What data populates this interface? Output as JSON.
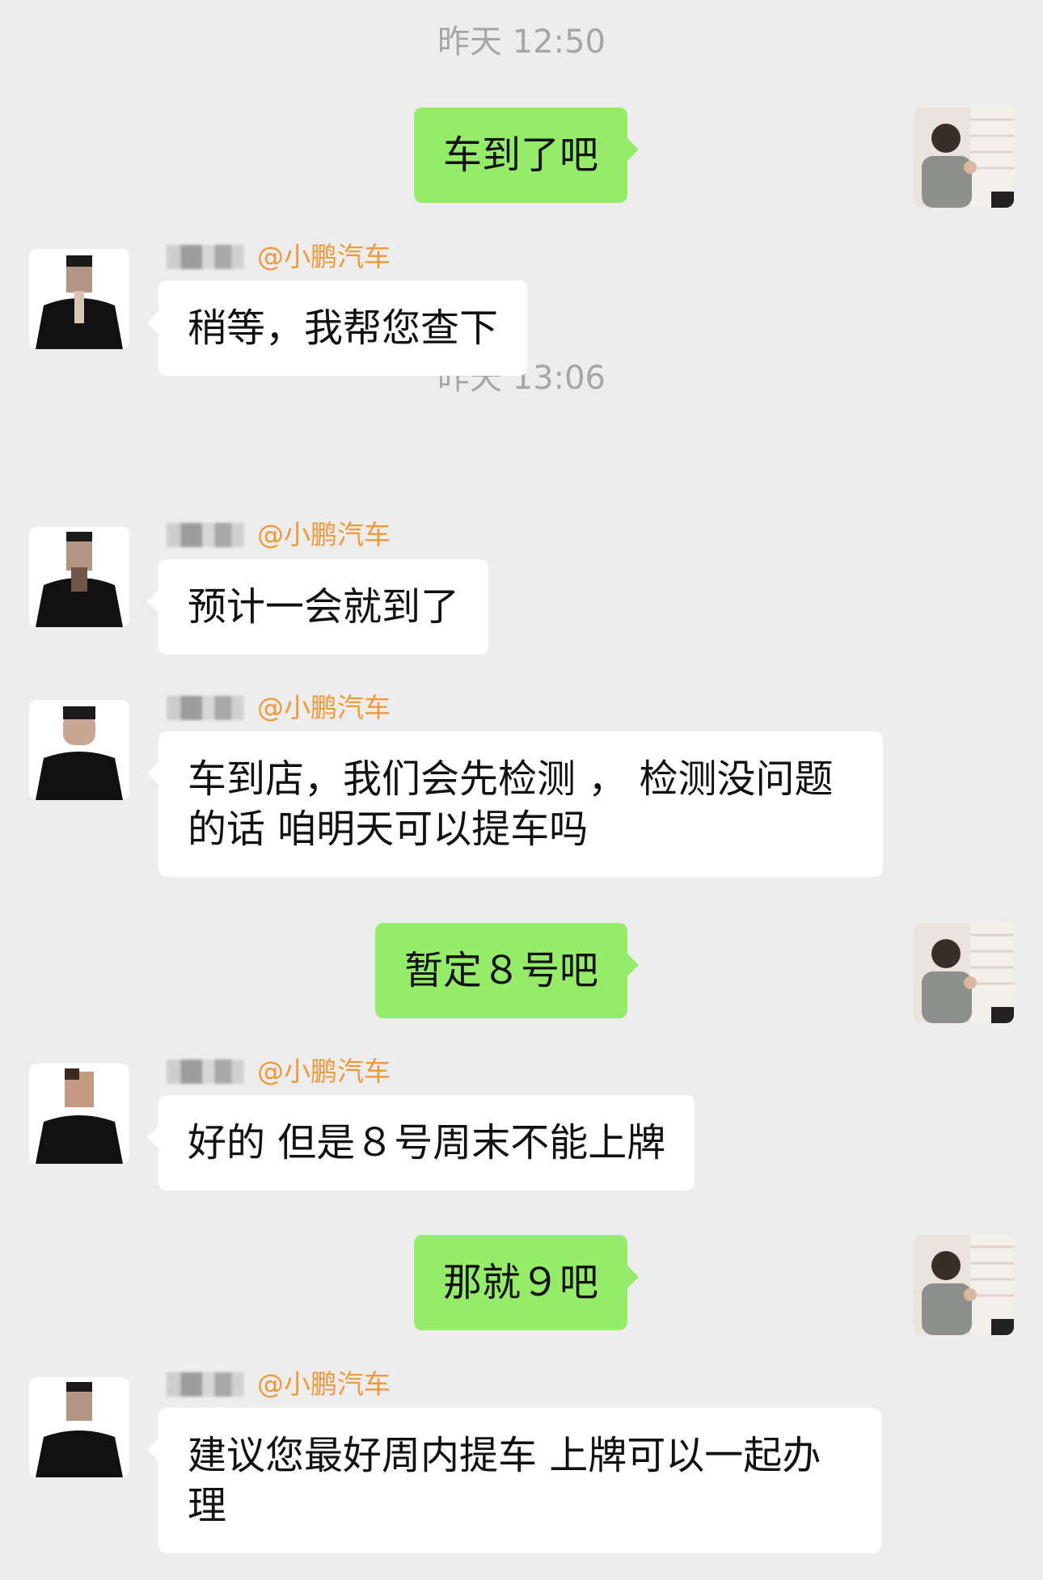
{
  "timestamps": [
    "昨天 12:50",
    "昨天 13:06"
  ],
  "messages": [
    {
      "side": "out",
      "text": "车到了吧"
    },
    {
      "side": "in",
      "company": "@小鹏汽车",
      "text": "稍等，我帮您查下"
    },
    {
      "side": "in",
      "company": "@小鹏汽车",
      "text": "预计一会就到了"
    },
    {
      "side": "in",
      "company": "@小鹏汽车",
      "text": "车到店，我们会先检测 ， 检测没问题的话 咱明天可以提车吗"
    },
    {
      "side": "out",
      "text": "暂定８号吧"
    },
    {
      "side": "in",
      "company": "@小鹏汽车",
      "text": "好的 但是８号周末不能上牌"
    },
    {
      "side": "out",
      "text": "那就９吧"
    },
    {
      "side": "in",
      "company": "@小鹏汽车",
      "text": "建议您最好周内提车 上牌可以一起办理"
    }
  ],
  "colors": {
    "background": "#ededed",
    "outgoing_bubble": "#95ec69",
    "incoming_bubble": "#ffffff",
    "company_tag": "#f0993a",
    "timestamp": "#a6a6a6"
  }
}
